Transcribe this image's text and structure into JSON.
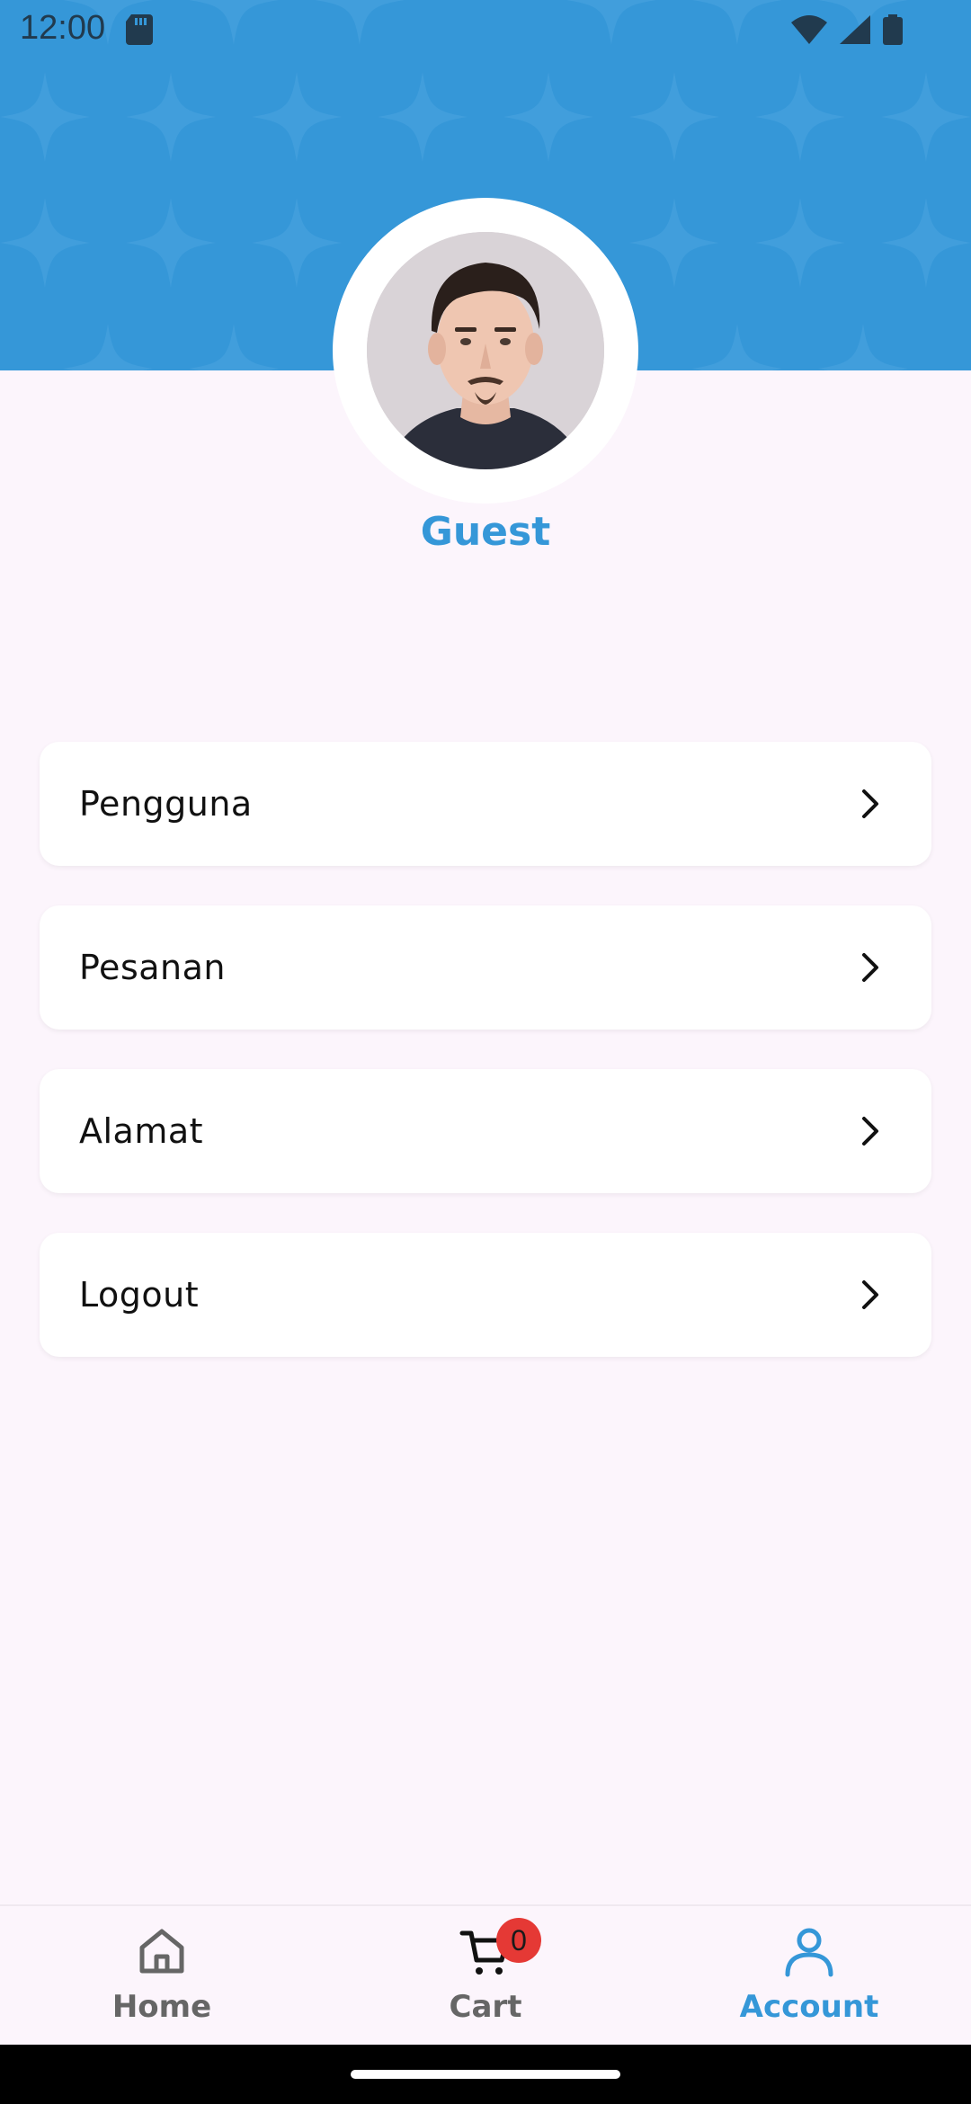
{
  "status_bar": {
    "time": "12:00",
    "icons": [
      "sd-card-icon",
      "wifi-icon",
      "cell-signal-icon",
      "battery-icon"
    ]
  },
  "profile": {
    "username": "Guest",
    "avatar_icon": "user-avatar-photo"
  },
  "menu": {
    "items": [
      {
        "label": "Pengguna"
      },
      {
        "label": "Pesanan"
      },
      {
        "label": "Alamat"
      },
      {
        "label": "Logout"
      }
    ]
  },
  "bottom_nav": {
    "home_label": "Home",
    "cart_label": "Cart",
    "cart_count": "0",
    "account_label": "Account",
    "active": "Account"
  },
  "colors": {
    "primary": "#3597d8",
    "background": "#fcf5fc",
    "badge": "#e53935",
    "inactive": "#666666"
  }
}
